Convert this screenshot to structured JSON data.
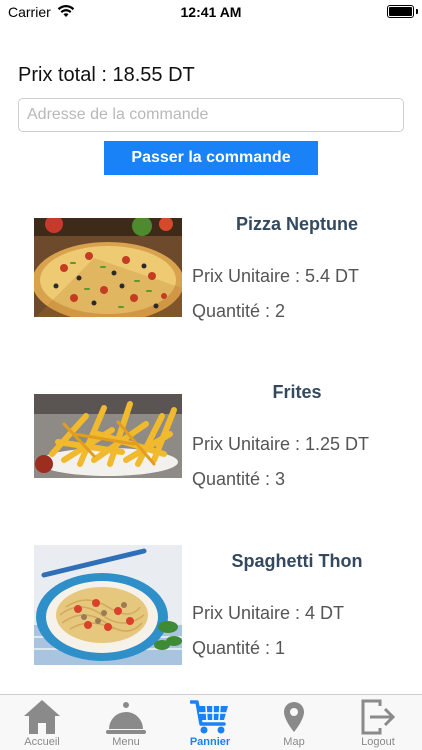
{
  "status_bar": {
    "carrier": "Carrier",
    "time": "12:41 AM"
  },
  "cart": {
    "total_label": "Prix total : 18.55 DT",
    "address_placeholder": "Adresse de la commande",
    "address_value": "",
    "order_button": "Passer la commande"
  },
  "items": [
    {
      "name": "Pizza Neptune",
      "price": "Prix Unitaire : 5.4 DT",
      "quantity": "Quantité : 2"
    },
    {
      "name": "Frites",
      "price": "Prix Unitaire : 1.25 DT",
      "quantity": "Quantité : 3"
    },
    {
      "name": "Spaghetti Thon",
      "price": "Prix Unitaire : 4 DT",
      "quantity": "Quantité : 1"
    }
  ],
  "tab_bar": {
    "active": "Pannier",
    "accent_color": "#1a82f7",
    "tabs": [
      {
        "label": "Accueil",
        "icon": "home-icon"
      },
      {
        "label": "Menu",
        "icon": "cloche-icon"
      },
      {
        "label": "Pannier",
        "icon": "cart-icon"
      },
      {
        "label": "Map",
        "icon": "map-pin-icon"
      },
      {
        "label": "Logout",
        "icon": "logout-icon"
      }
    ]
  }
}
